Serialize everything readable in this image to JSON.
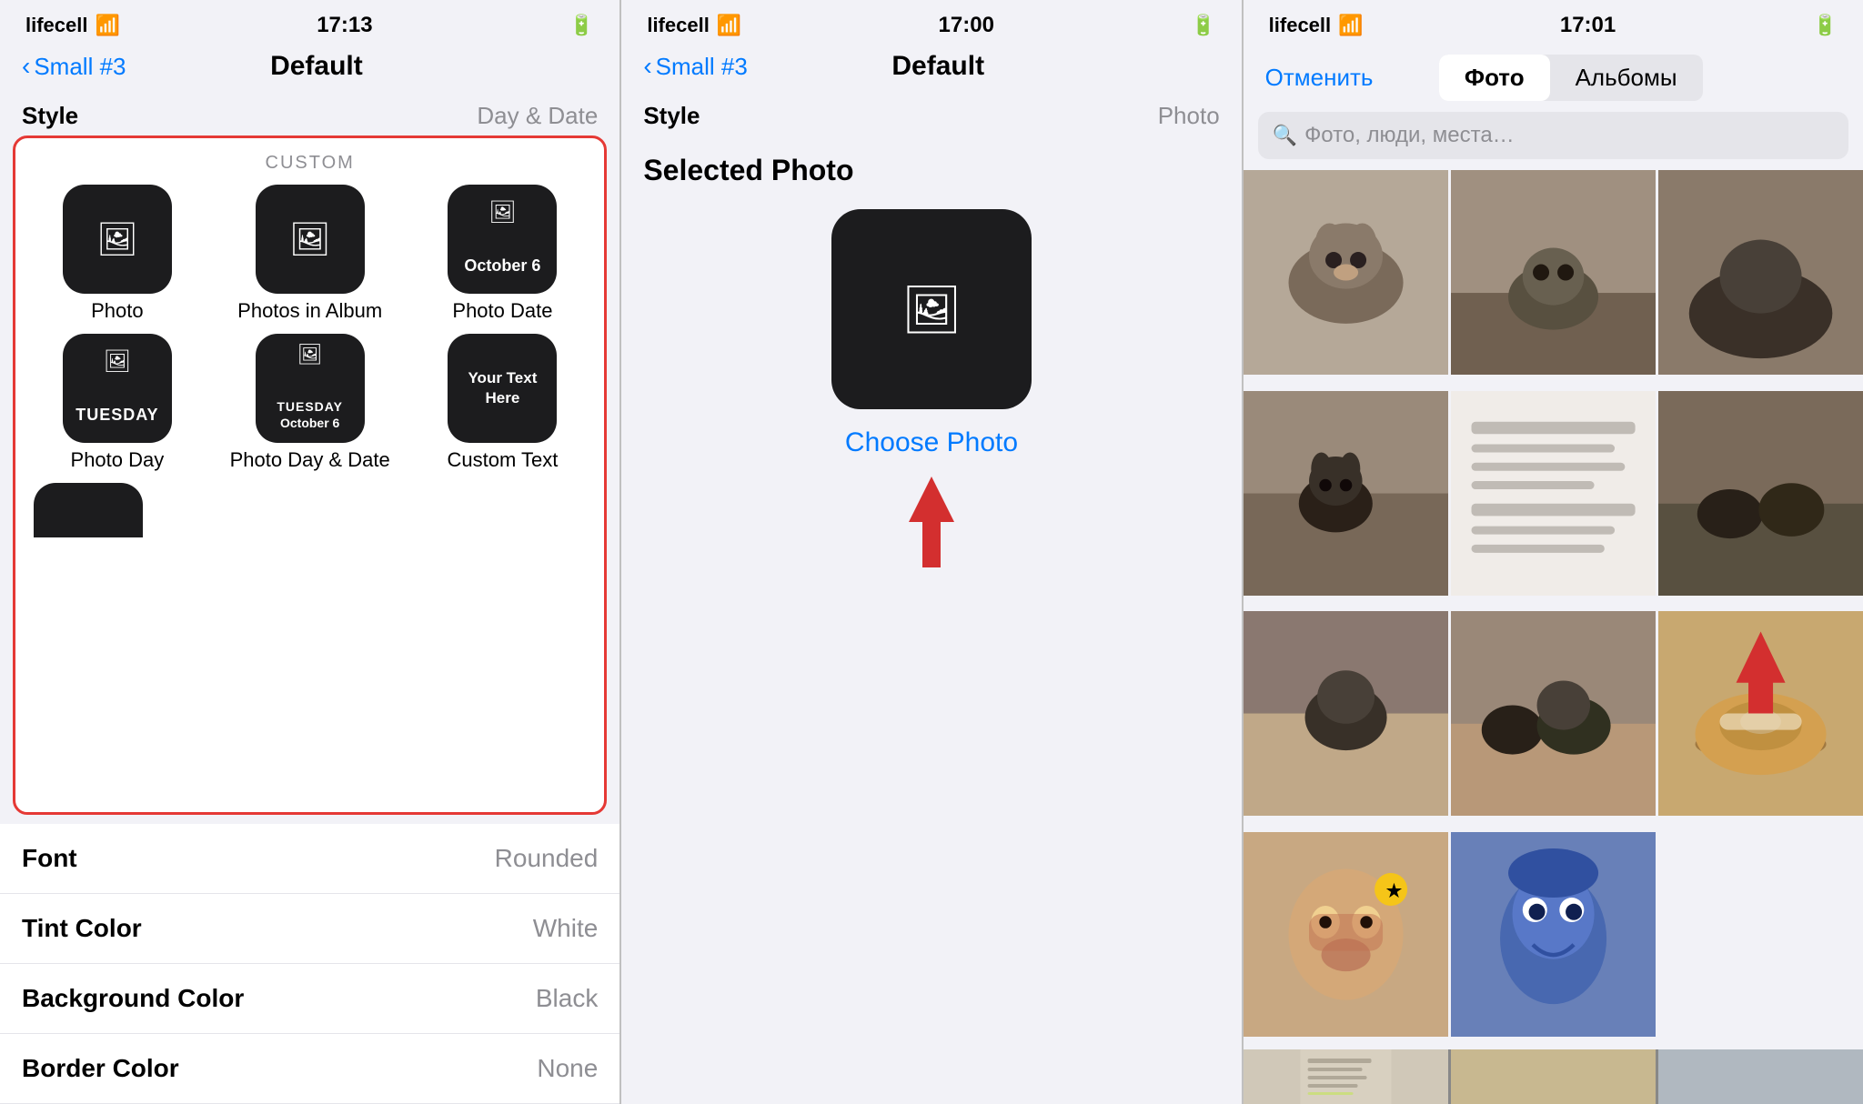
{
  "panel1": {
    "status": {
      "carrier": "lifecell",
      "time": "17:13",
      "battery": "🔋"
    },
    "nav": {
      "back_label": "Small #3",
      "title": "Default"
    },
    "section": {
      "style_label": "Style",
      "style_value": "Day & Date"
    },
    "custom_section_label": "CUSTOM",
    "widgets": [
      {
        "id": "photo",
        "label": "Photo",
        "type": "icon",
        "icon": "🖼"
      },
      {
        "id": "photos-album",
        "label": "Photos in Album",
        "type": "icon",
        "icon": "🖼"
      },
      {
        "id": "photo-date",
        "label": "Photo Date",
        "type": "date",
        "date_text": "October 6",
        "icon": "🖼"
      },
      {
        "id": "photo-day",
        "label": "Photo Day",
        "type": "day",
        "day_text": "TUESDAY",
        "icon": "🖼"
      },
      {
        "id": "photo-day-date",
        "label": "Photo Day & Date",
        "type": "day-date",
        "day_text": "TUESDAY",
        "date_text": "October 6",
        "icon": "🖼"
      },
      {
        "id": "custom-text",
        "label": "Custom Text",
        "type": "text",
        "text": "Your Text Here",
        "icon": "🖼"
      }
    ],
    "settings": [
      {
        "label": "Font",
        "value": "Rounded"
      },
      {
        "label": "Tint Color",
        "value": "White"
      },
      {
        "label": "Background Color",
        "value": "Black"
      },
      {
        "label": "Border Color",
        "value": "None"
      }
    ]
  },
  "panel2": {
    "status": {
      "carrier": "lifecell",
      "time": "17:00"
    },
    "nav": {
      "back_label": "Small #3",
      "title": "Default"
    },
    "section": {
      "style_label": "Style",
      "style_value": "Photo"
    },
    "selected_photo_title": "Selected Photo",
    "choose_photo_label": "Choose Photo"
  },
  "panel3": {
    "status": {
      "carrier": "lifecell",
      "time": "17:01"
    },
    "cancel_label": "Отменить",
    "tabs": [
      {
        "id": "photos",
        "label": "Фото",
        "active": true
      },
      {
        "id": "albums",
        "label": "Альбомы",
        "active": false
      }
    ],
    "search_placeholder": "Фото, люди, места…",
    "photos": [
      {
        "id": "p1",
        "color": "#b5a898",
        "desc": "cat lying"
      },
      {
        "id": "p2",
        "color": "#a09080",
        "desc": "cat on floor"
      },
      {
        "id": "p3",
        "color": "#8a7a6a",
        "desc": "cat dark"
      },
      {
        "id": "p4",
        "color": "#9a8a7a",
        "desc": "cat black"
      },
      {
        "id": "p5",
        "color": "#d8d0c8",
        "desc": "text message"
      },
      {
        "id": "p6",
        "color": "#7a6a5a",
        "desc": "cats together"
      },
      {
        "id": "p7",
        "color": "#8a7870",
        "desc": "kitten"
      },
      {
        "id": "p8",
        "color": "#9a8878",
        "desc": "two cats"
      },
      {
        "id": "p9",
        "color": "#c8a870",
        "desc": "food donut with arrow"
      },
      {
        "id": "p10",
        "color": "#c8a882",
        "desc": "face with mask"
      },
      {
        "id": "p11",
        "color": "#6880b8",
        "desc": "blue face"
      },
      {
        "id": "p12",
        "color": "#d0c0a0",
        "desc": "text partial"
      }
    ]
  }
}
